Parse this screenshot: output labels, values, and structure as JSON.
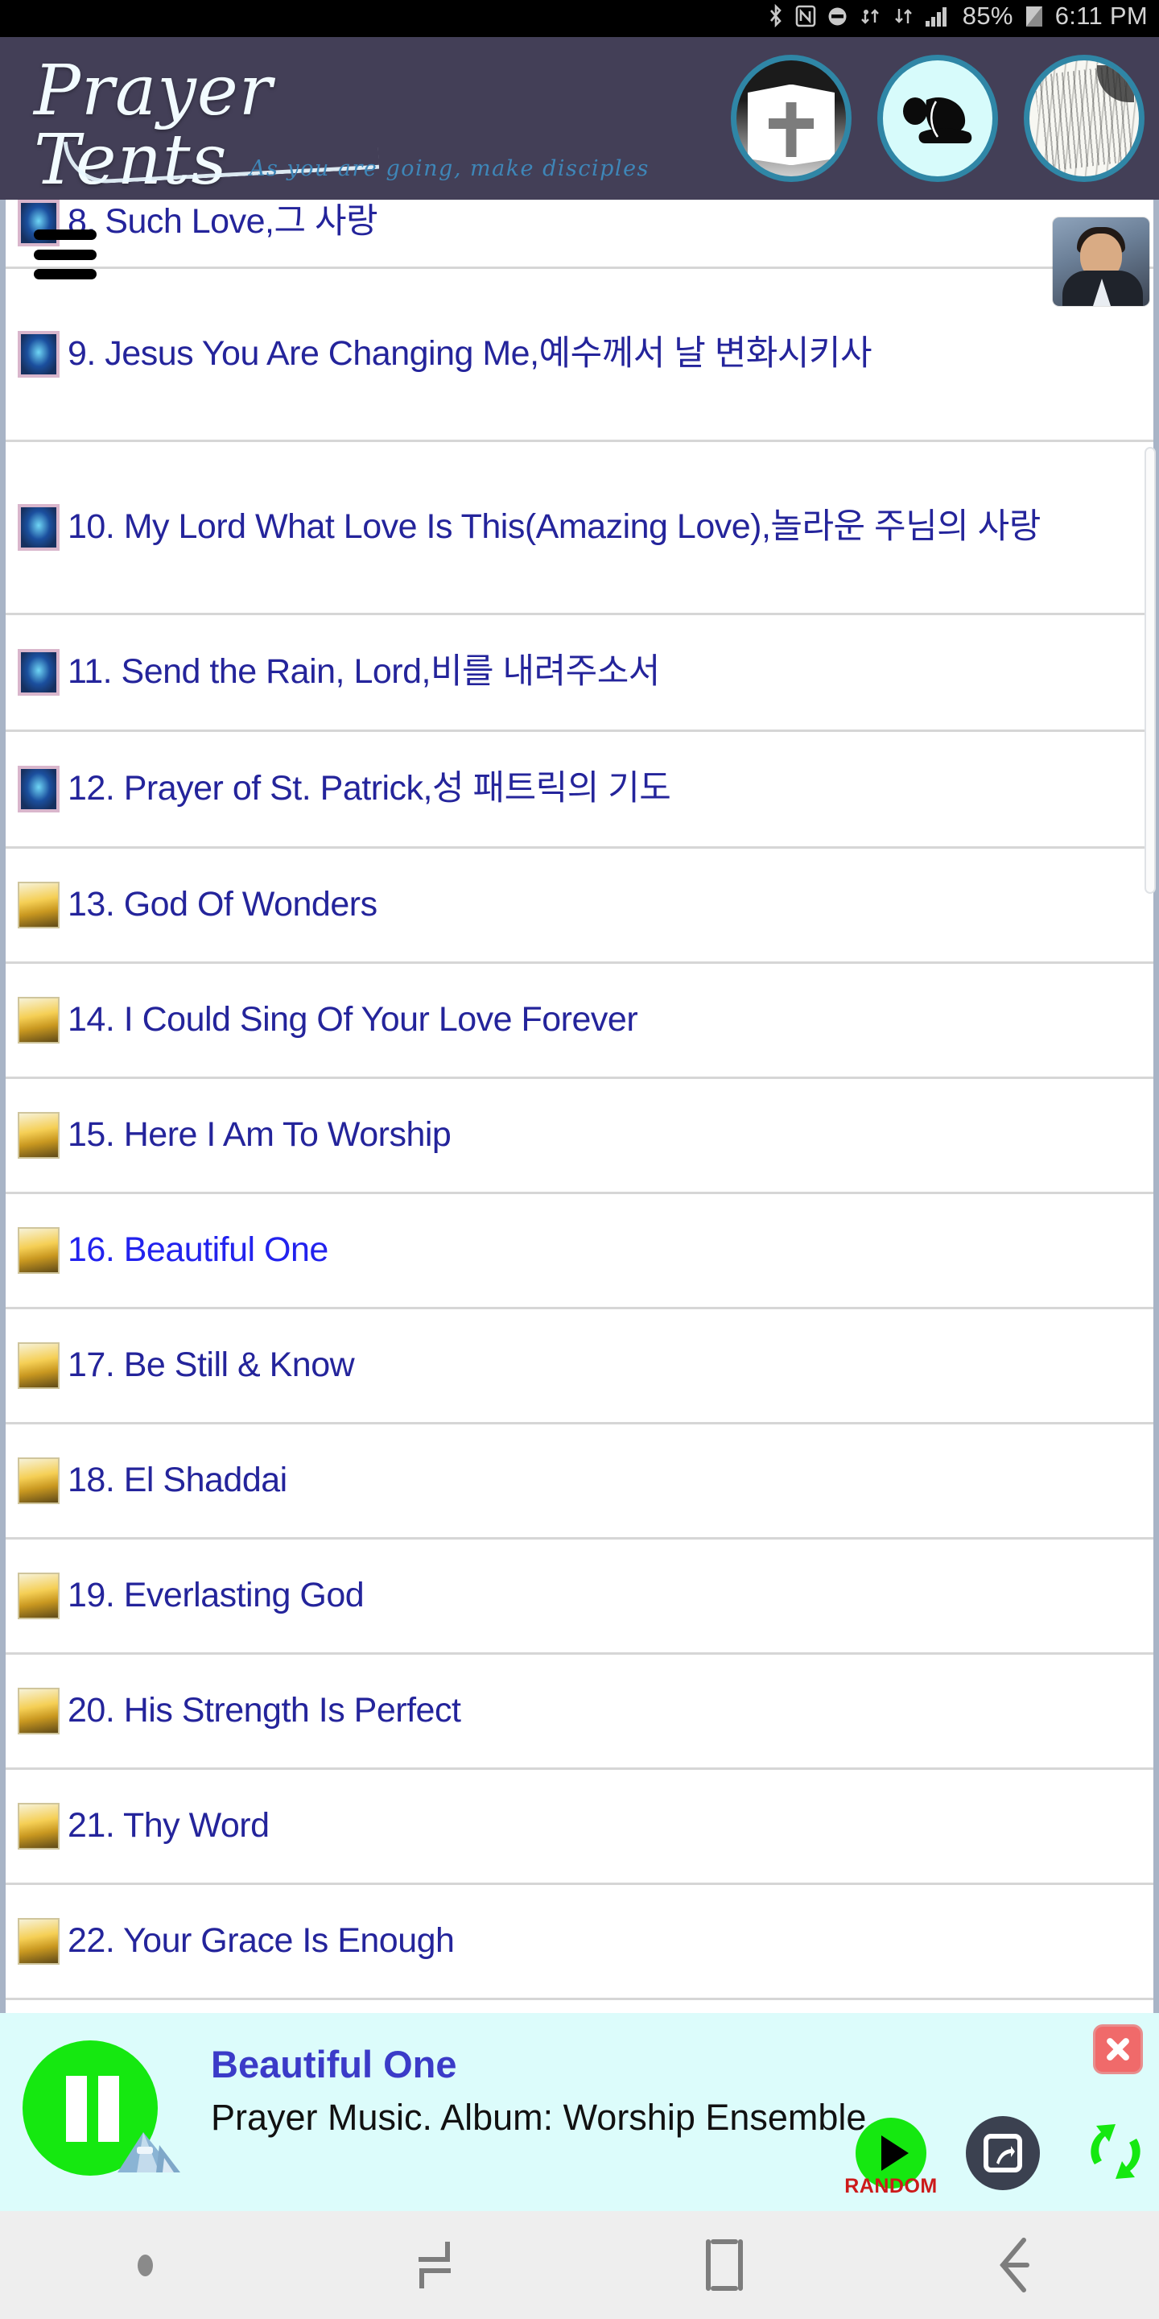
{
  "statusbar": {
    "icons": [
      "bluetooth-icon",
      "nfc-icon",
      "dnd-icon",
      "sync-icon",
      "data-transfer-icon",
      "signal-icon",
      "battery-icon"
    ],
    "battery": "85%",
    "time": "6:11 PM"
  },
  "header": {
    "logo_title": "Prayer Tents",
    "logo_tagline": "As you are going, make disciples",
    "buttons": [
      {
        "name": "bible-button",
        "label": "Bible"
      },
      {
        "name": "prayer-button",
        "label": "Prayer"
      },
      {
        "name": "hymnal-button",
        "label": "Hymnal"
      }
    ]
  },
  "list": {
    "items": [
      {
        "num": "8.",
        "title": "8. Such Love,그 사랑",
        "art": "cat-a",
        "playing": false
      },
      {
        "num": "9.",
        "title": "9. Jesus You Are Changing Me,예수께서 날 변화시키사",
        "art": "cat-a",
        "playing": false
      },
      {
        "num": "10.",
        "title": "10. My Lord What Love Is This(Amazing Love),놀라운 주님의 사랑",
        "art": "cat-a",
        "playing": false
      },
      {
        "num": "11.",
        "title": "11. Send the Rain, Lord,비를 내려주소서",
        "art": "cat-a",
        "playing": false
      },
      {
        "num": "12.",
        "title": "12. Prayer of St. Patrick,성 패트릭의 기도",
        "art": "cat-a",
        "playing": false
      },
      {
        "num": "13.",
        "title": "13. God Of Wonders",
        "art": "cat-b",
        "playing": false
      },
      {
        "num": "14.",
        "title": "14. I Could Sing Of Your Love Forever",
        "art": "cat-b",
        "playing": false
      },
      {
        "num": "15.",
        "title": "15. Here I Am To Worship",
        "art": "cat-b",
        "playing": false
      },
      {
        "num": "16.",
        "title": "16. Beautiful One",
        "art": "cat-b",
        "playing": true
      },
      {
        "num": "17.",
        "title": "17. Be Still & Know",
        "art": "cat-b",
        "playing": false
      },
      {
        "num": "18.",
        "title": "18. El Shaddai",
        "art": "cat-b",
        "playing": false
      },
      {
        "num": "19.",
        "title": "19. Everlasting God",
        "art": "cat-b",
        "playing": false
      },
      {
        "num": "20.",
        "title": "20. His Strength Is Perfect",
        "art": "cat-b",
        "playing": false
      },
      {
        "num": "21.",
        "title": "21. Thy Word",
        "art": "cat-b",
        "playing": false
      },
      {
        "num": "22.",
        "title": "22. Your Grace Is Enough",
        "art": "cat-b",
        "playing": false
      }
    ]
  },
  "player": {
    "track_title": "Beautiful One",
    "track_subtitle": "Prayer Music. Album: Worship Ensemble",
    "random_label": "RANDOM",
    "state": "playing",
    "controls": [
      "pause-button",
      "random-play-button",
      "share-button",
      "repeat-button",
      "close-button"
    ]
  },
  "navbar": {
    "items": [
      "dot-indicator",
      "recents-button",
      "home-button",
      "back-button"
    ]
  },
  "colors": {
    "header_bg": "#433f57",
    "accent_teal": "#2f86a6",
    "link_blue": "#24249b",
    "playing_blue": "#2222ee",
    "player_bg": "#dcfcfb",
    "green": "#15e810",
    "close_red": "#f06a6a"
  }
}
